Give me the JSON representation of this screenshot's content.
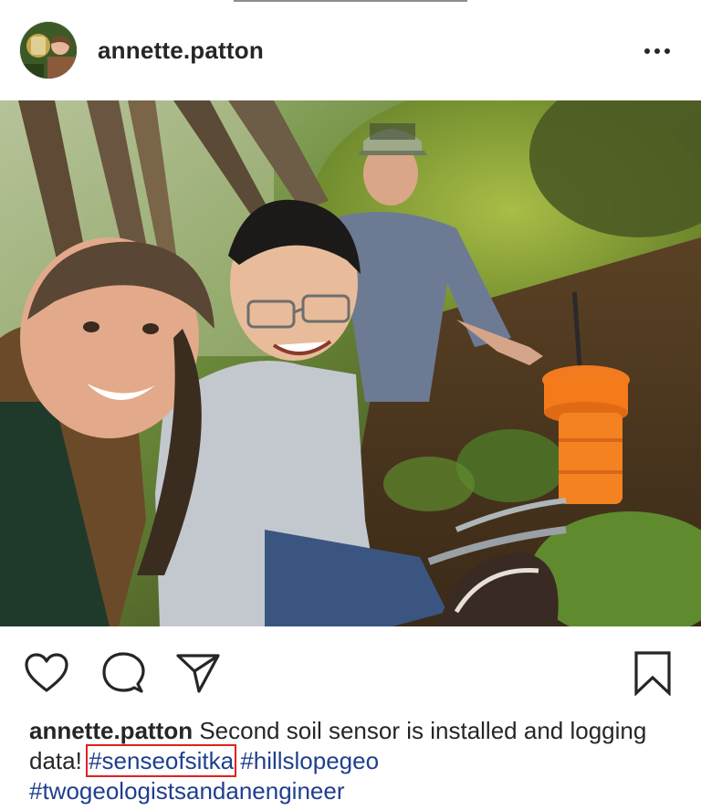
{
  "post": {
    "username": "annette.patton",
    "caption": {
      "username": "annette.patton",
      "text_before": " Second soil sensor is installed and logging data! ",
      "hashtags": [
        "#senseofsitka",
        "#hillslopegeo",
        "#twogeologistsandanengineer"
      ],
      "highlighted_hashtag_index": 0
    },
    "icons": {
      "more": "more-options-icon",
      "like": "heart-icon",
      "comment": "comment-icon",
      "share": "send-icon",
      "save": "bookmark-icon"
    },
    "colors": {
      "text": "#262626",
      "hashtag": "#1f3f8f",
      "highlight_box": "#e02020"
    }
  }
}
